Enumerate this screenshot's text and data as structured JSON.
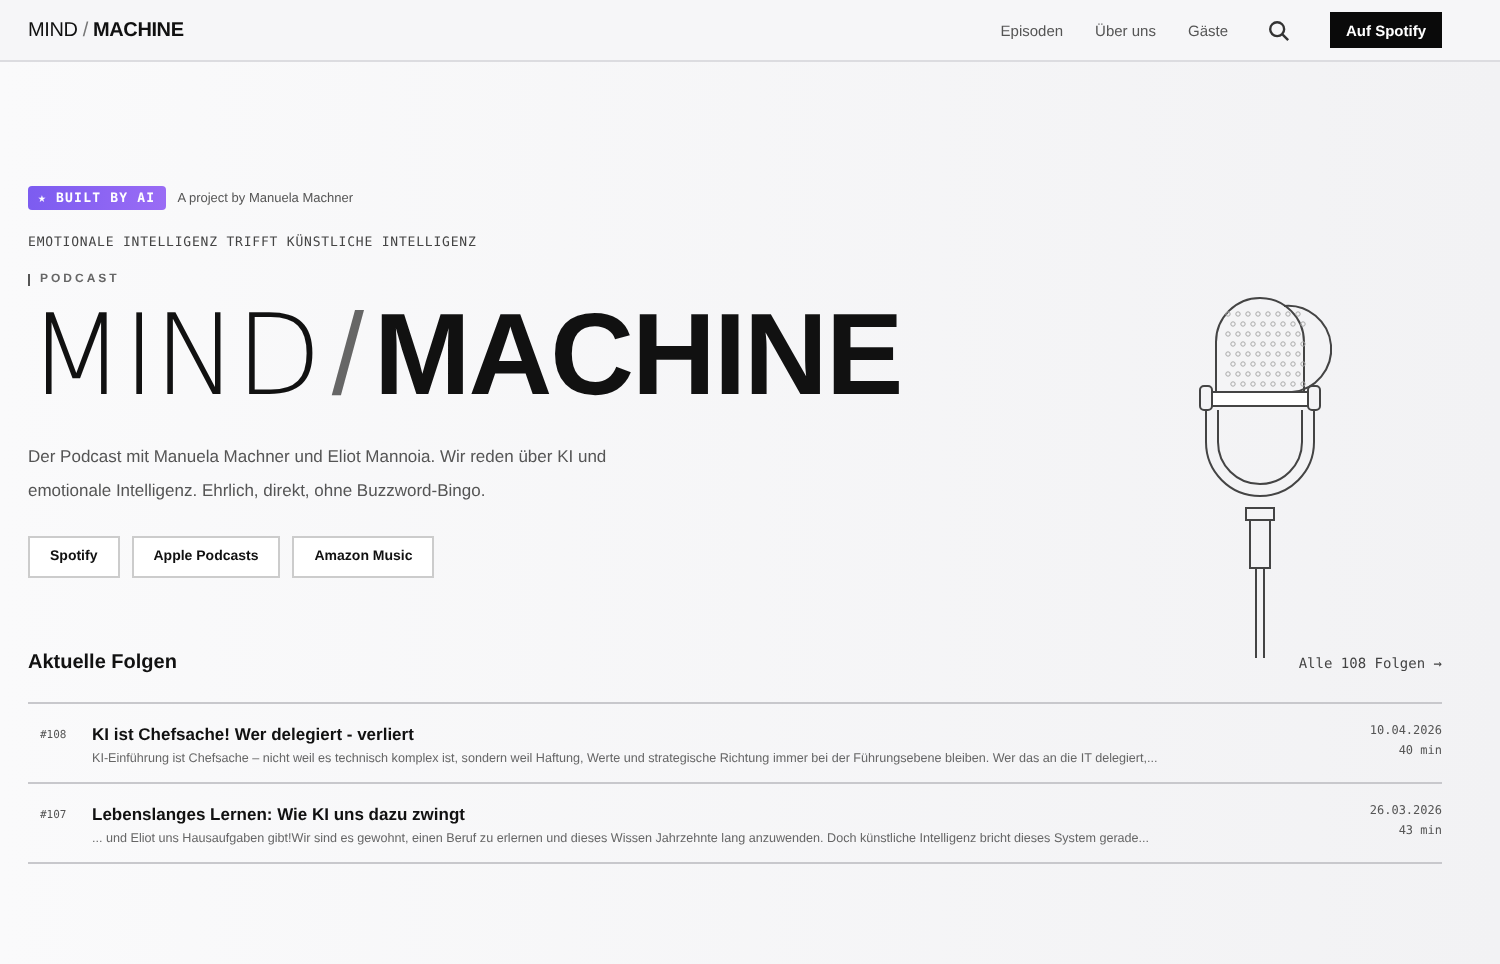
{
  "nav": {
    "logo": {
      "light": "MIND",
      "slash": "/",
      "bold": "MACHINE"
    },
    "links": [
      "Episoden",
      "Über uns",
      "Gäste"
    ],
    "cta": "Auf Spotify"
  },
  "hero": {
    "badge": "★ BUILT BY AI",
    "credit": "A project by Manuela Machner",
    "tagline": "EMOTIONALE INTELLIGENZ TRIFFT KÜNSTLICHE INTELLIGENZ",
    "label": "PODCAST",
    "title": {
      "light": "MIND",
      "slash": "/",
      "bold": "MACHINE"
    },
    "description": "Der Podcast mit Manuela Machner und Eliot Mannoia. Wir reden über KI und emotionale Intelligenz. Ehrlich, direkt, ohne Buzzword-Bingo.",
    "platforms": [
      "Spotify",
      "Apple Podcasts",
      "Amazon Music"
    ]
  },
  "episodes": {
    "heading": "Aktuelle Folgen",
    "all_link": "Alle 108 Folgen →",
    "items": [
      {
        "number": "#108",
        "title": "KI ist Chefsache! Wer delegiert - verliert",
        "summary": "KI-Einführung ist Chefsache – nicht weil es technisch komplex ist, sondern weil Haftung, Werte und strategische Richtung immer bei der Führungsebene bleiben. Wer das an die IT delegiert,...",
        "date": "10.04.2026",
        "duration": "40 min"
      },
      {
        "number": "#107",
        "title": "Lebenslanges Lernen: Wie KI uns dazu zwingt",
        "summary": "... und Eliot uns Hausaufgaben gibt!Wir sind es gewohnt, einen Beruf zu erlernen und dieses Wissen Jahrzehnte lang anzuwenden. Doch künstliche Intelligenz bricht dieses System gerade...",
        "date": "26.03.2026",
        "duration": "43 min"
      }
    ]
  }
}
